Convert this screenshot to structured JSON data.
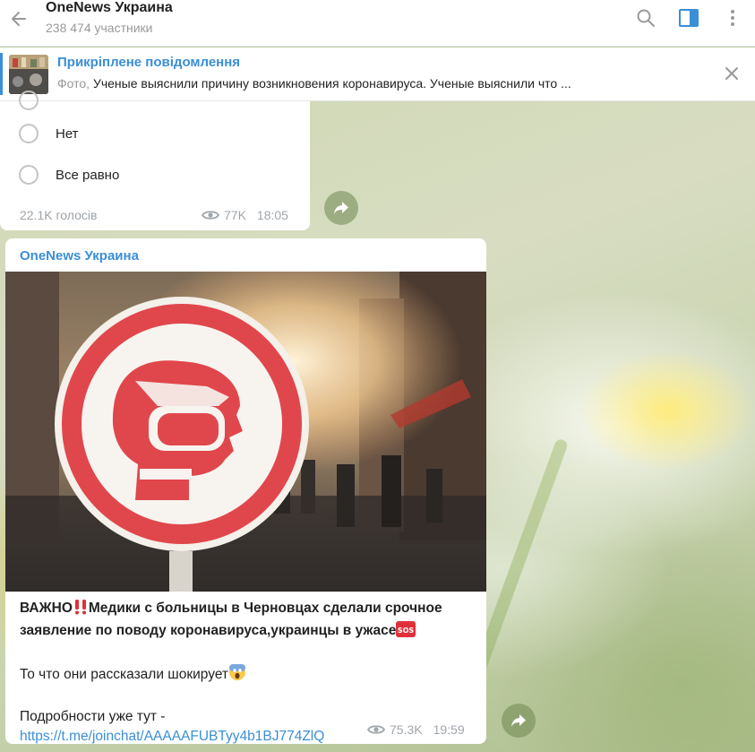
{
  "header": {
    "title": "OneNews Украина",
    "subtitle": "238 474 участники",
    "icons": [
      "back-arrow-icon",
      "search-icon",
      "sidebar-panel-icon",
      "more-vertical-icon"
    ]
  },
  "pinned": {
    "title": "Прикріплене повідомлення",
    "prefix": "Фото,",
    "text": " Ученые выяснили причину возникновения коронавируса.  Ученые выяснили что ..."
  },
  "poll": {
    "options": [
      "Нет",
      "Все равно"
    ],
    "votes": "22.1K голосів",
    "views": "77K",
    "time": "18:05"
  },
  "post": {
    "author": "OneNews Украина",
    "headline_start": "ВАЖНО",
    "headline_rest": "Медики с больницы в Черновцах сделали срочное заявление по поводу коронавируса,украинцы в ужасе",
    "line2": "То что они рассказали шокирует",
    "line3": "Подробности уже тут -",
    "link": "https://t.me/joinchat/AAAAAFUBTyy4b1BJ774ZlQ",
    "views": "75.3K",
    "time": "19:59"
  },
  "colors": {
    "accent": "#3a8fd6",
    "meta": "#a0a6ab",
    "sign_red": "#e0474c"
  }
}
